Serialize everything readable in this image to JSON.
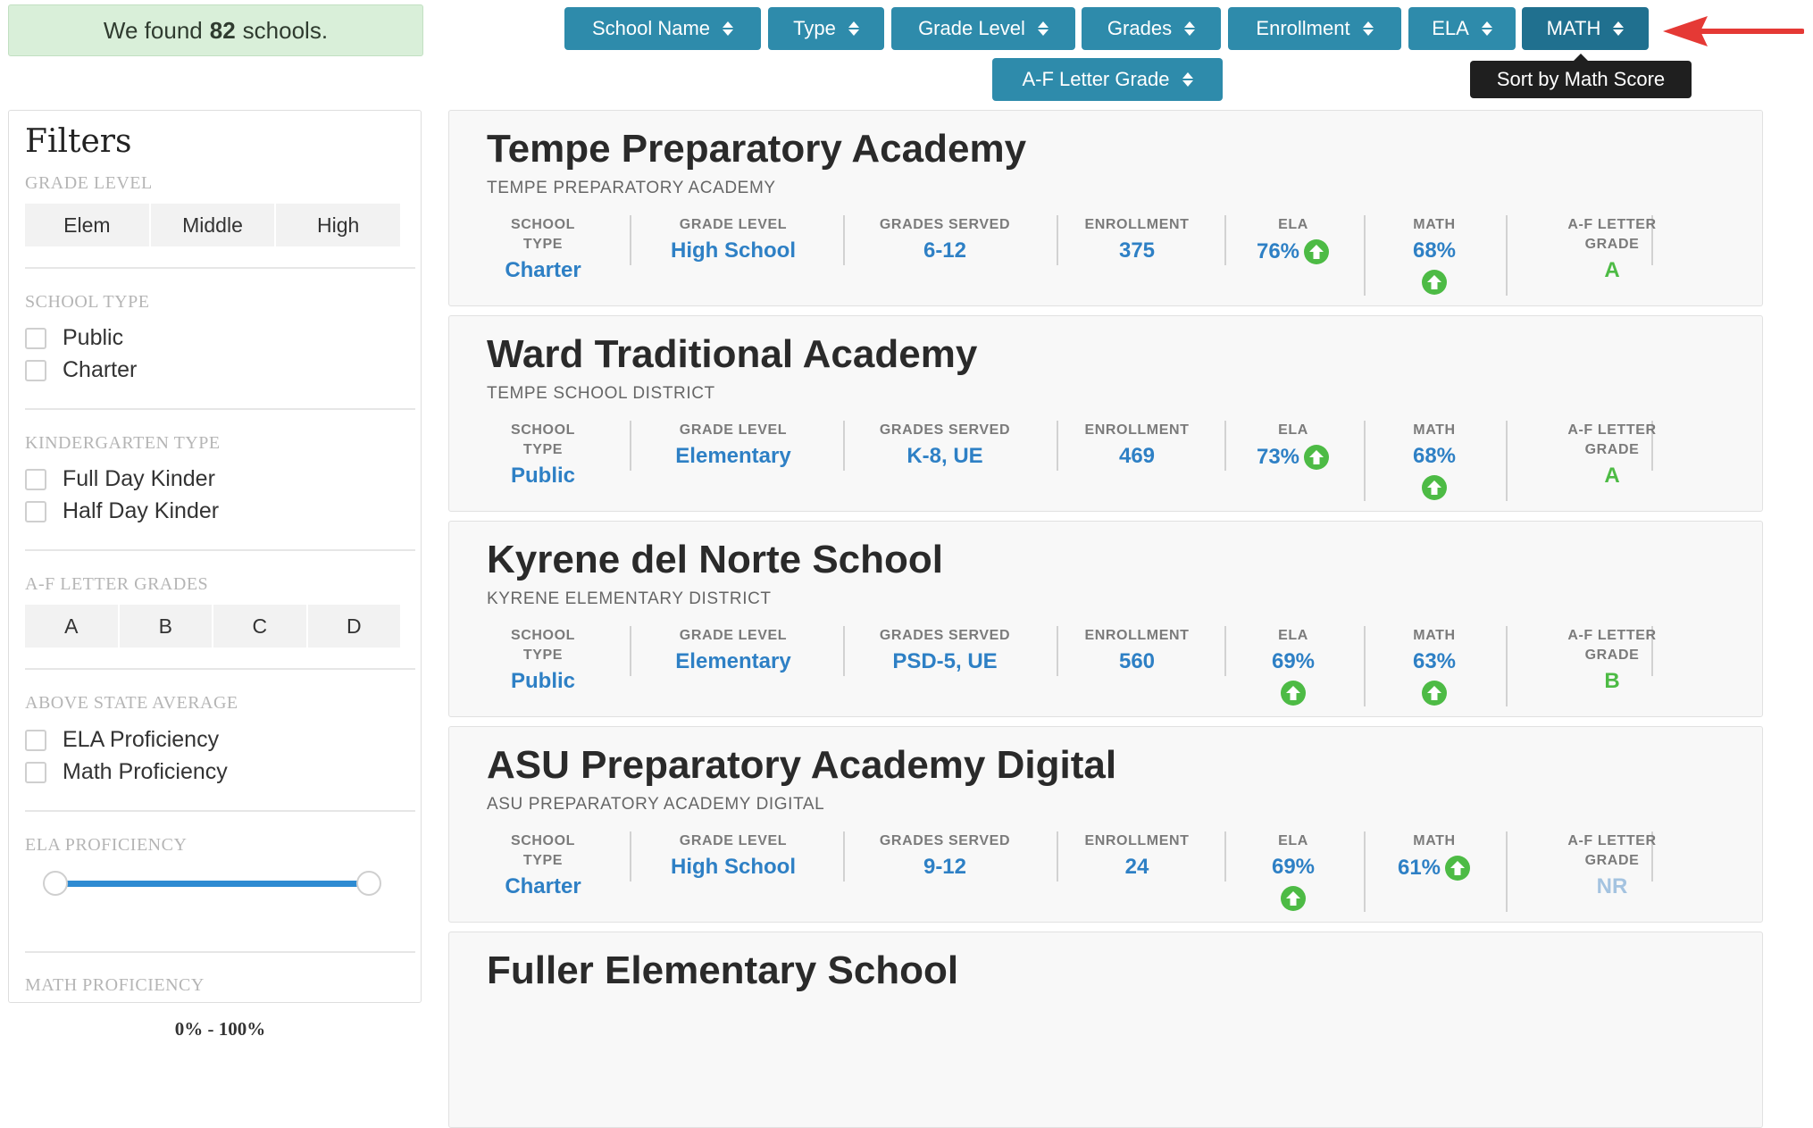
{
  "results": {
    "prefix": "We found",
    "count": "82",
    "suffix": "schools."
  },
  "sort_buttons": [
    {
      "label": "School Name"
    },
    {
      "label": "Type"
    },
    {
      "label": "Grade Level"
    },
    {
      "label": "Grades"
    },
    {
      "label": "Enrollment"
    },
    {
      "label": "ELA"
    },
    {
      "label": "MATH",
      "active": true
    },
    {
      "label": "A-F Letter Grade"
    }
  ],
  "tooltip": "Sort by Math Score",
  "filters": {
    "title": "Filters",
    "grade_level": {
      "heading": "GRADE LEVEL",
      "options": [
        "Elem",
        "Middle",
        "High"
      ]
    },
    "school_type": {
      "heading": "SCHOOL TYPE",
      "options": [
        "Public",
        "Charter"
      ]
    },
    "kinder_type": {
      "heading": "KINDERGARTEN TYPE",
      "options": [
        "Full Day Kinder",
        "Half Day Kinder"
      ]
    },
    "letter_grades": {
      "heading": "A-F LETTER GRADES",
      "options": [
        "A",
        "B",
        "C",
        "D"
      ]
    },
    "above_avg": {
      "heading": "ABOVE STATE AVERAGE",
      "options": [
        "ELA Proficiency",
        "Math Proficiency"
      ]
    },
    "ela_prof": {
      "heading": "ELA PROFICIENCY",
      "range": "0% - 100%",
      "min": 0,
      "max": 100
    },
    "math_prof": {
      "heading": "MATH PROFICIENCY"
    }
  },
  "column_labels": {
    "school_type_1": "SCHOOL",
    "school_type_2": "TYPE",
    "grade_level": "GRADE LEVEL",
    "grades_served": "GRADES SERVED",
    "enrollment": "ENROLLMENT",
    "ela": "ELA",
    "math": "MATH",
    "letter_1": "A-F LETTER",
    "letter_2": "GRADE"
  },
  "colors": {
    "accent": "#2e8bab",
    "value_blue": "#2e80c5",
    "grade_green": "#4dbb45",
    "up_icon": "#4dbb45"
  },
  "schools": [
    {
      "name": "Tempe Preparatory Academy",
      "district": "TEMPE PREPARATORY ACADEMY",
      "type": "Charter",
      "grade_level": "High School",
      "grades": "6-12",
      "enrollment": "375",
      "ela": "76%",
      "math": "68%",
      "letter": "A"
    },
    {
      "name": "Ward Traditional Academy",
      "district": "TEMPE SCHOOL DISTRICT",
      "type": "Public",
      "grade_level": "Elementary",
      "grades": "K-8, UE",
      "enrollment": "469",
      "ela": "73%",
      "math": "68%",
      "letter": "A"
    },
    {
      "name": "Kyrene del Norte School",
      "district": "KYRENE ELEMENTARY DISTRICT",
      "type": "Public",
      "grade_level": "Elementary",
      "grades": "PSD-5, UE",
      "enrollment": "560",
      "ela": "69%",
      "math": "63%",
      "letter": "B"
    },
    {
      "name": "ASU Preparatory Academy Digital",
      "district": "ASU PREPARATORY ACADEMY DIGITAL",
      "type": "Charter",
      "grade_level": "High School",
      "grades": "9-12",
      "enrollment": "24",
      "ela": "69%",
      "math": "61%",
      "letter": "NR"
    },
    {
      "name": "Fuller Elementary School"
    }
  ]
}
